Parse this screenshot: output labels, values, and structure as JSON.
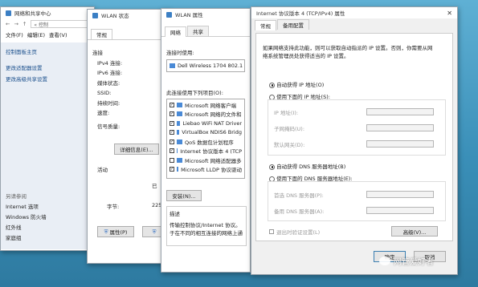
{
  "w1": {
    "title": "网络和共享中心",
    "nav": "控制",
    "menu": [
      "文件(F)",
      "编辑(E)",
      "查看(V)"
    ],
    "home": "控制面板主页",
    "links": [
      "更改适配器设置",
      "更改高级共享设置"
    ],
    "see_also": "另请参阅",
    "bottom": [
      "Internet 选项",
      "Windows 防火墙",
      "红外线",
      "家庭组"
    ]
  },
  "w2": {
    "title": "WLAN 状态",
    "tab": "常规",
    "sec_conn": "连接",
    "rows": [
      "IPv4 连接:",
      "IPv6 连接:",
      "媒体状态:",
      "SSID:",
      "持续时间:",
      "速度:"
    ],
    "signal": "信号质量:",
    "details": "详细信息(E)...",
    "sec_act": "活动",
    "sent_trunc": "已",
    "bytes": "字节:",
    "bytes_val": "225",
    "props": "属性(P)"
  },
  "w3": {
    "title": "WLAN 属性",
    "tabs": [
      "网络",
      "共享"
    ],
    "connect_using": "连接时使用:",
    "adapter": "Dell Wireless 1704 802.1",
    "items_label": "此连接使用下列项目(O):",
    "items": [
      "Microsoft 网络客户端",
      "Microsoft 网络的文件和",
      "Liebao WiFi NAT Driver",
      "VirtualBox NDIS6 Bridg",
      "QoS 数据包计划程序",
      "Internet 协议版本 4 (TCP",
      "Microsoft 网络适配器多",
      "Microsoft LLDP 协议驱动"
    ],
    "install": "安装(N)...",
    "desc": "描述",
    "desc_text": [
      "传输控制协议/Internet 协议。",
      "于在不同的相互连接的网络上通"
    ]
  },
  "w4": {
    "title": "Internet 协议版本 4 (TCP/IPv4) 属性",
    "tabs": [
      "常规",
      "备用配置"
    ],
    "intro": [
      "如果网络支持此功能，则可以获取自动指派的 IP 设置。否则，你需要从网",
      "络系统管理员处获得适当的 IP 设置。"
    ],
    "auto_ip": "自动获得 IP 地址(O)",
    "manual_ip": "使用下面的 IP 地址(S):",
    "ip": "IP 地址(I):",
    "mask": "子网掩码(U):",
    "gw": "默认网关(D):",
    "auto_dns": "自动获得 DNS 服务器地址(B)",
    "manual_dns": "使用下面的 DNS 服务器地址(E):",
    "dns1": "首选 DNS 服务器(P):",
    "dns2": "备用 DNS 服务器(A):",
    "validate": "退出时验证设置(L)",
    "advanced": "高级(V)...",
    "ok": "确定",
    "cancel": "取消",
    "watermark": "网管爱好者"
  }
}
